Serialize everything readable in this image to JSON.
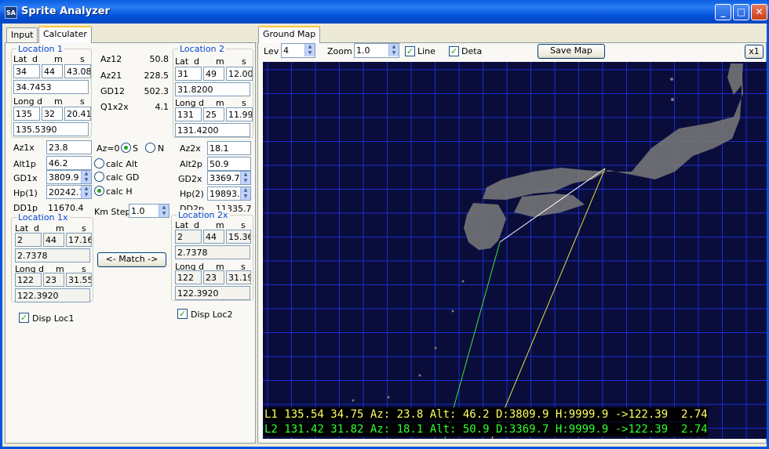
{
  "window": {
    "title": "Sprite Analyzer",
    "icon_text": "SA"
  },
  "tabs": {
    "input": "Input",
    "calculater": "Calculater",
    "ground_map": "Ground Map"
  },
  "loc1": {
    "title": "Location 1",
    "lat_hdr": "Lat",
    "d": "d",
    "m": "m",
    "s": "s",
    "lat_d": "34",
    "lat_m": "44",
    "lat_s": "43.08",
    "lat_dec": "34.7453",
    "long_hdr": "Long",
    "long_d": "135",
    "long_m": "32",
    "long_s": "20.41",
    "long_dec": "135.5390"
  },
  "loc2": {
    "title": "Location 2",
    "lat_d": "31",
    "lat_m": "49",
    "lat_s": "12.00",
    "lat_dec": "31.8200",
    "long_d": "131",
    "long_m": "25",
    "long_s": "11.99",
    "long_dec": "131.4200"
  },
  "middle": {
    "az12_label": "Az12",
    "az12": "50.8",
    "az21_label": "Az21",
    "az21": "228.5",
    "gd12_label": "GD12",
    "gd12": "502.3",
    "q1x2x_label": "Q1x2x",
    "q1x2x": "4.1"
  },
  "calc": {
    "az1x_label": "Az1x",
    "az1x": "23.8",
    "alt1p_label": "Alt1p",
    "alt1p": "46.2",
    "gd1x_label": "GD1x",
    "gd1x": "3809.9",
    "hp1_label": "Hp(1)",
    "hp1": "20242.7",
    "dd1p_label": "DD1p",
    "dd1p": "11670.4",
    "az0_label": "Az=0",
    "s_label": "S",
    "n_label": "N",
    "calc_alt": "calc Alt",
    "calc_gd": "calc GD",
    "calc_h": "calc H",
    "km_step_label": "Km Step",
    "km_step": "1.0",
    "az2x_label": "Az2x",
    "az2x": "18.1",
    "alt2p_label": "Alt2p",
    "alt2p": "50.9",
    "gd2x_label": "GD2x",
    "gd2x": "3369.7",
    "hp2_label": "Hp(2)",
    "hp2": "19893.1",
    "dd2p_label": "DD2p",
    "dd2p": "11335.7"
  },
  "loc1x": {
    "title": "Location 1x",
    "lat_d": "2",
    "lat_m": "44",
    "lat_s": "17.16",
    "lat_dec": "2.7378",
    "long_d": "122",
    "long_m": "23",
    "long_s": "31.55",
    "long_dec": "122.3920"
  },
  "loc2x": {
    "title": "Location 2x",
    "lat_d": "2",
    "lat_m": "44",
    "lat_s": "15.36",
    "lat_dec": "2.7378",
    "long_d": "122",
    "long_m": "23",
    "long_s": "31.19",
    "long_dec": "122.3920"
  },
  "match_button": "<- Match ->",
  "disp_loc1": "Disp Loc1",
  "disp_loc2": "Disp Loc2",
  "map_toolbar": {
    "lev_label": "Lev",
    "lev": "4",
    "zoom_label": "Zoom",
    "zoom": "1.0",
    "line_label": "Line",
    "deta_label": "Deta",
    "save_map": "Save Map",
    "x1": "x1"
  },
  "map_status": {
    "l1": "L1 135.54 34.75 Az: 23.8 Alt: 46.2 D:3809.9 H:9999.9 ->122.39  2.74",
    "l2": "L2 131.42 31.82 Az: 18.1 Alt: 50.9 D:3369.7 H:9999.9 ->122.39  2.74",
    "l1_color": "#ffff66",
    "l2_color": "#33ff33"
  },
  "colors": {
    "map_bg": "#0a0d3a",
    "grid": "#1a2dd0",
    "land": "#7a7a7a",
    "line_l1_l2": "#ffffff",
    "line_l1": "#e0e040",
    "line_l2": "#40e040"
  }
}
